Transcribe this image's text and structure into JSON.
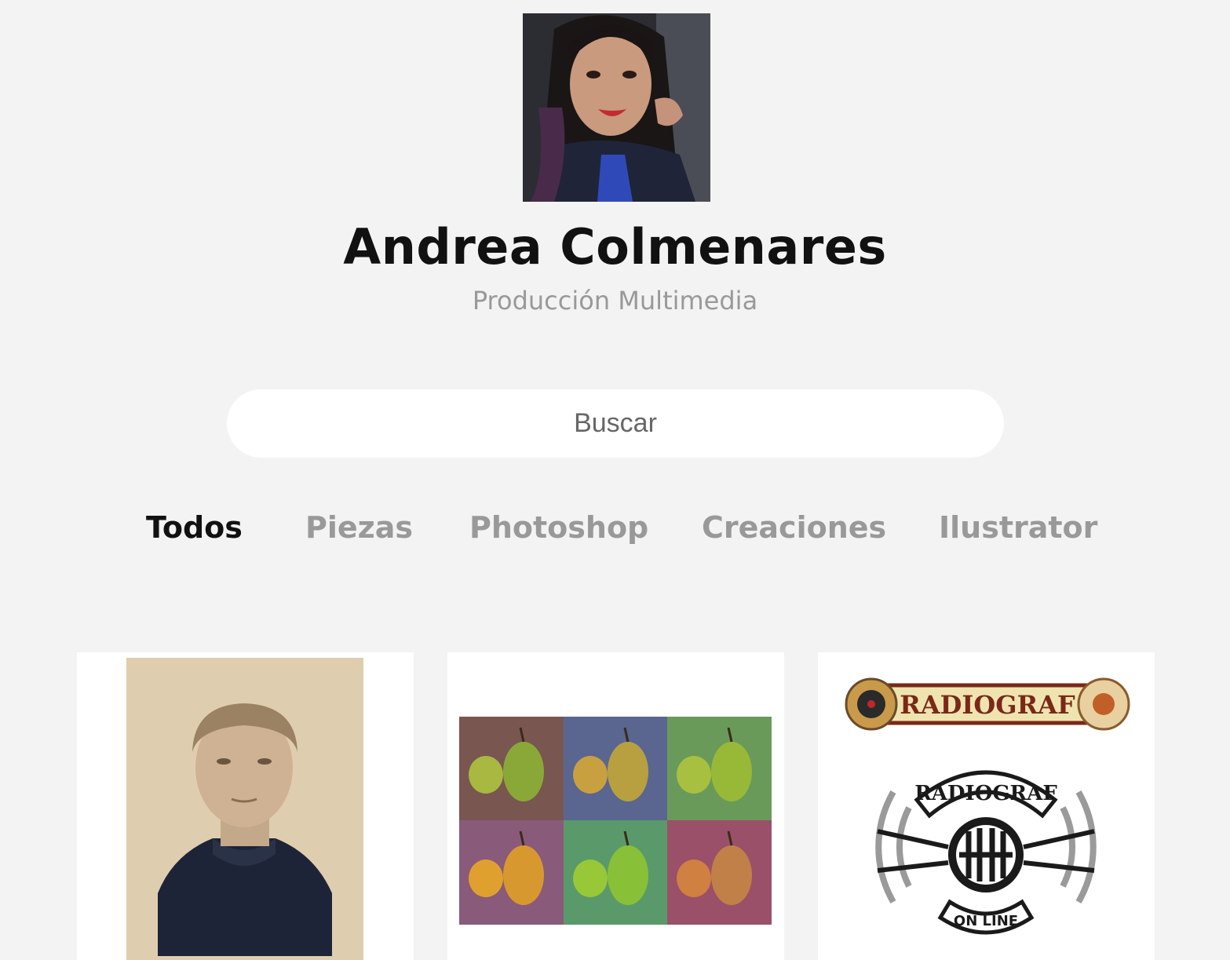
{
  "profile": {
    "name": "Andrea Colmenares",
    "subtitle": "Producción Multimedia",
    "avatar_alt": "profile-photo"
  },
  "search": {
    "placeholder": "Buscar",
    "value": ""
  },
  "filters": [
    {
      "label": "Todos",
      "active": true
    },
    {
      "label": "Piezas",
      "active": false
    },
    {
      "label": "Photoshop",
      "active": false
    },
    {
      "label": "Creaciones",
      "active": false
    },
    {
      "label": "Ilustrator",
      "active": false
    }
  ],
  "projects": [
    {
      "thumbnail": "vintage-portrait"
    },
    {
      "thumbnail": "pop-art-pears"
    },
    {
      "thumbnail": "radiograf-logo",
      "logo_text_top": "RADIOGRAF",
      "logo_text_badge": "RADIOGRAF",
      "logo_text_bottom": "ON LINE"
    }
  ],
  "colors": {
    "background": "#f3f3f3",
    "text_primary": "#111111",
    "text_muted": "#999999",
    "card": "#ffffff"
  }
}
